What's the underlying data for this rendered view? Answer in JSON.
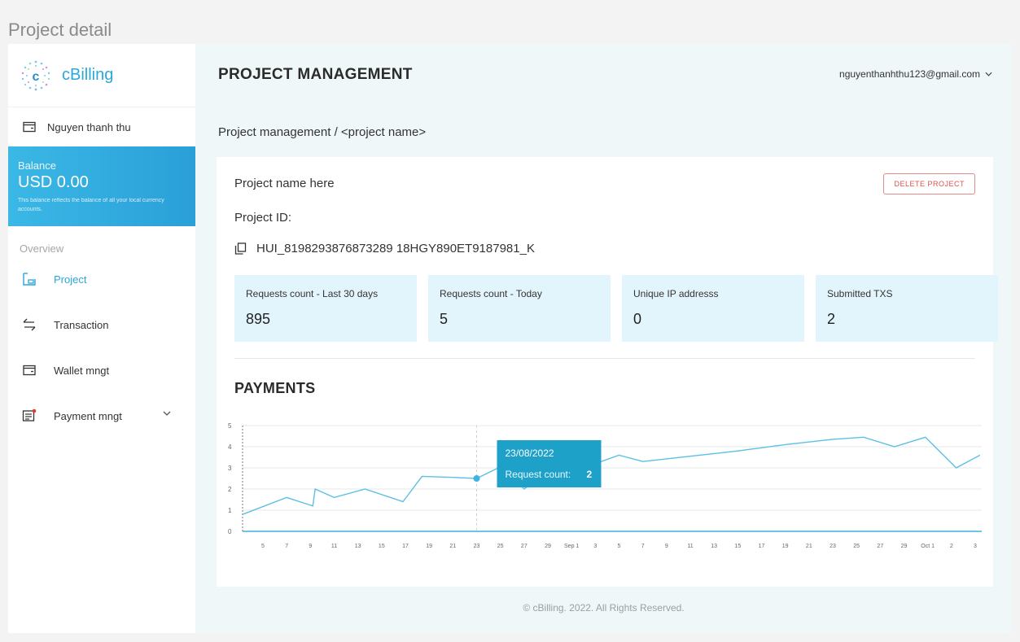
{
  "window": {
    "title": "Project detail"
  },
  "brand": {
    "name": "cBilling",
    "logo_letter": "c"
  },
  "sidebar": {
    "user_name": "Nguyen thanh thu",
    "balance": {
      "label": "Balance",
      "amount": "USD 0.00",
      "note": "This balance reflects the balance of all your local currency accounts."
    },
    "section_label": "Overview",
    "items": [
      {
        "label": "Project",
        "icon": "project-icon",
        "active": true
      },
      {
        "label": "Transaction",
        "icon": "transfer-arrows-icon",
        "active": false
      },
      {
        "label": "Wallet mngt",
        "icon": "wallet-icon",
        "active": false
      },
      {
        "label": "Payment mngt",
        "icon": "receipt-icon",
        "active": false,
        "has_dropdown": true
      }
    ]
  },
  "header": {
    "title": "PROJECT MANAGEMENT",
    "user_email": "nguyenthanhthu123@gmail.com"
  },
  "breadcrumb": "Project management / <project name>",
  "project": {
    "name": "Project name here",
    "delete_label": "DELETE PROJECT",
    "id_label": "Project ID:",
    "id_value": "HUI_8198293876873289 18HGY890ET9187981_K"
  },
  "stats": [
    {
      "label": "Requests count - Last 30 days",
      "value": "895"
    },
    {
      "label": "Requests count - Today",
      "value": "5"
    },
    {
      "label": "Unique IP addresss",
      "value": "0"
    },
    {
      "label": "Submitted TXS",
      "value": "2"
    }
  ],
  "payments_title": "PAYMENTS",
  "colors": {
    "accent": "#29a7d8",
    "tooltip_bg": "#1ea1c9",
    "danger": "#d9534f",
    "stat_bg": "#e3f5fc"
  },
  "chart_data": {
    "type": "line",
    "x_ticks": [
      "5",
      "7",
      "9",
      "11",
      "13",
      "15",
      "17",
      "19",
      "21",
      "23",
      "25",
      "27",
      "29",
      "Sep 1",
      "3",
      "5",
      "7",
      "9",
      "11",
      "13",
      "15",
      "17",
      "19",
      "21",
      "23",
      "25",
      "27",
      "29",
      "Oct 1",
      "2",
      "3"
    ],
    "y_ticks": [
      "0",
      "1",
      "2",
      "3",
      "4",
      "5"
    ],
    "ylim": [
      0,
      5
    ],
    "grid": true,
    "series": [
      {
        "points": [
          [
            0,
            0.8
          ],
          [
            1.0,
            1.6
          ],
          [
            2.1,
            1.2
          ],
          [
            2.2,
            2.0
          ],
          [
            3.0,
            1.6
          ],
          [
            4.3,
            2.0
          ],
          [
            5.9,
            1.4
          ],
          [
            6.7,
            2.6
          ],
          [
            8.0,
            2.55
          ],
          [
            9.0,
            2.5
          ],
          [
            10.1,
            3.1
          ],
          [
            11.0,
            2.0
          ],
          [
            12.0,
            2.8
          ],
          [
            14.0,
            3.2
          ],
          [
            15.0,
            3.6
          ],
          [
            16.0,
            3.3
          ],
          [
            18.0,
            3.55
          ],
          [
            20.0,
            3.8
          ],
          [
            22.0,
            4.1
          ],
          [
            24.0,
            4.35
          ],
          [
            25.3,
            4.45
          ],
          [
            26.6,
            4.0
          ],
          [
            27.9,
            4.45
          ],
          [
            29.2,
            3.0
          ],
          [
            30.2,
            3.6
          ]
        ]
      }
    ],
    "tooltip": {
      "date": "23/08/2022",
      "label": "Request count:",
      "value": "2"
    },
    "highlight_index": 9,
    "crosshair_x": 9.0
  },
  "footer": "© cBilling. 2022. All Rights Reserved."
}
